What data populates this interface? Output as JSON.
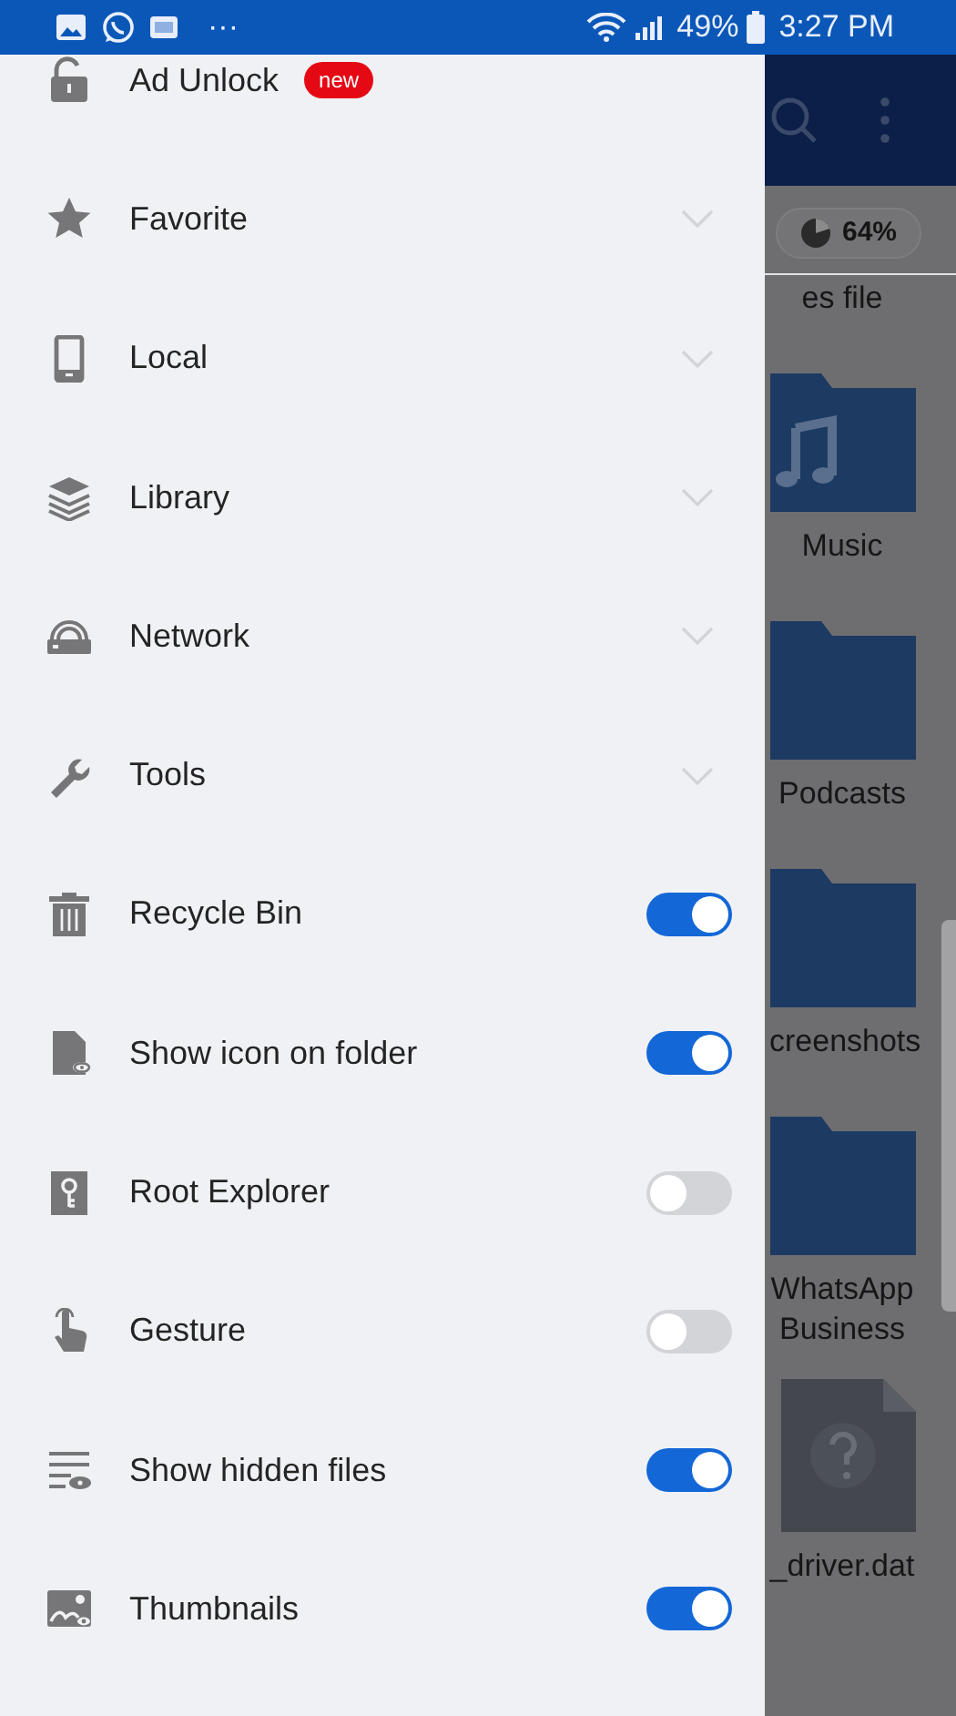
{
  "status_bar": {
    "battery": "49%",
    "time": "3:27 PM",
    "notification_more": "···"
  },
  "drawer": {
    "items": [
      {
        "label": "Ad Unlock",
        "kind": "badge",
        "badge": "new"
      },
      {
        "label": "Favorite",
        "kind": "expandable",
        "expanded": false
      },
      {
        "label": "Local",
        "kind": "expandable",
        "expanded": false
      },
      {
        "label": "Library",
        "kind": "expandable",
        "expanded": false
      },
      {
        "label": "Network",
        "kind": "expandable",
        "expanded": false
      },
      {
        "label": "Tools",
        "kind": "expandable",
        "expanded": false
      },
      {
        "label": "Recycle Bin",
        "kind": "toggle",
        "on": true
      },
      {
        "label": "Show icon on folder",
        "kind": "toggle",
        "on": true
      },
      {
        "label": "Root Explorer",
        "kind": "toggle",
        "on": false
      },
      {
        "label": "Gesture",
        "kind": "toggle",
        "on": false
      },
      {
        "label": "Show hidden files",
        "kind": "toggle",
        "on": true
      },
      {
        "label": "Thumbnails",
        "kind": "toggle",
        "on": true
      }
    ]
  },
  "background": {
    "storage": "64%",
    "files": [
      {
        "name": "es file",
        "kind": "label"
      },
      {
        "name": "Music",
        "kind": "music-folder"
      },
      {
        "name": "Podcasts",
        "kind": "folder"
      },
      {
        "name": "creenshots",
        "kind": "folder"
      },
      {
        "name": "WhatsApp Business",
        "kind": "folder"
      },
      {
        "name": "_driver.dat",
        "kind": "unknown-file"
      }
    ]
  }
}
